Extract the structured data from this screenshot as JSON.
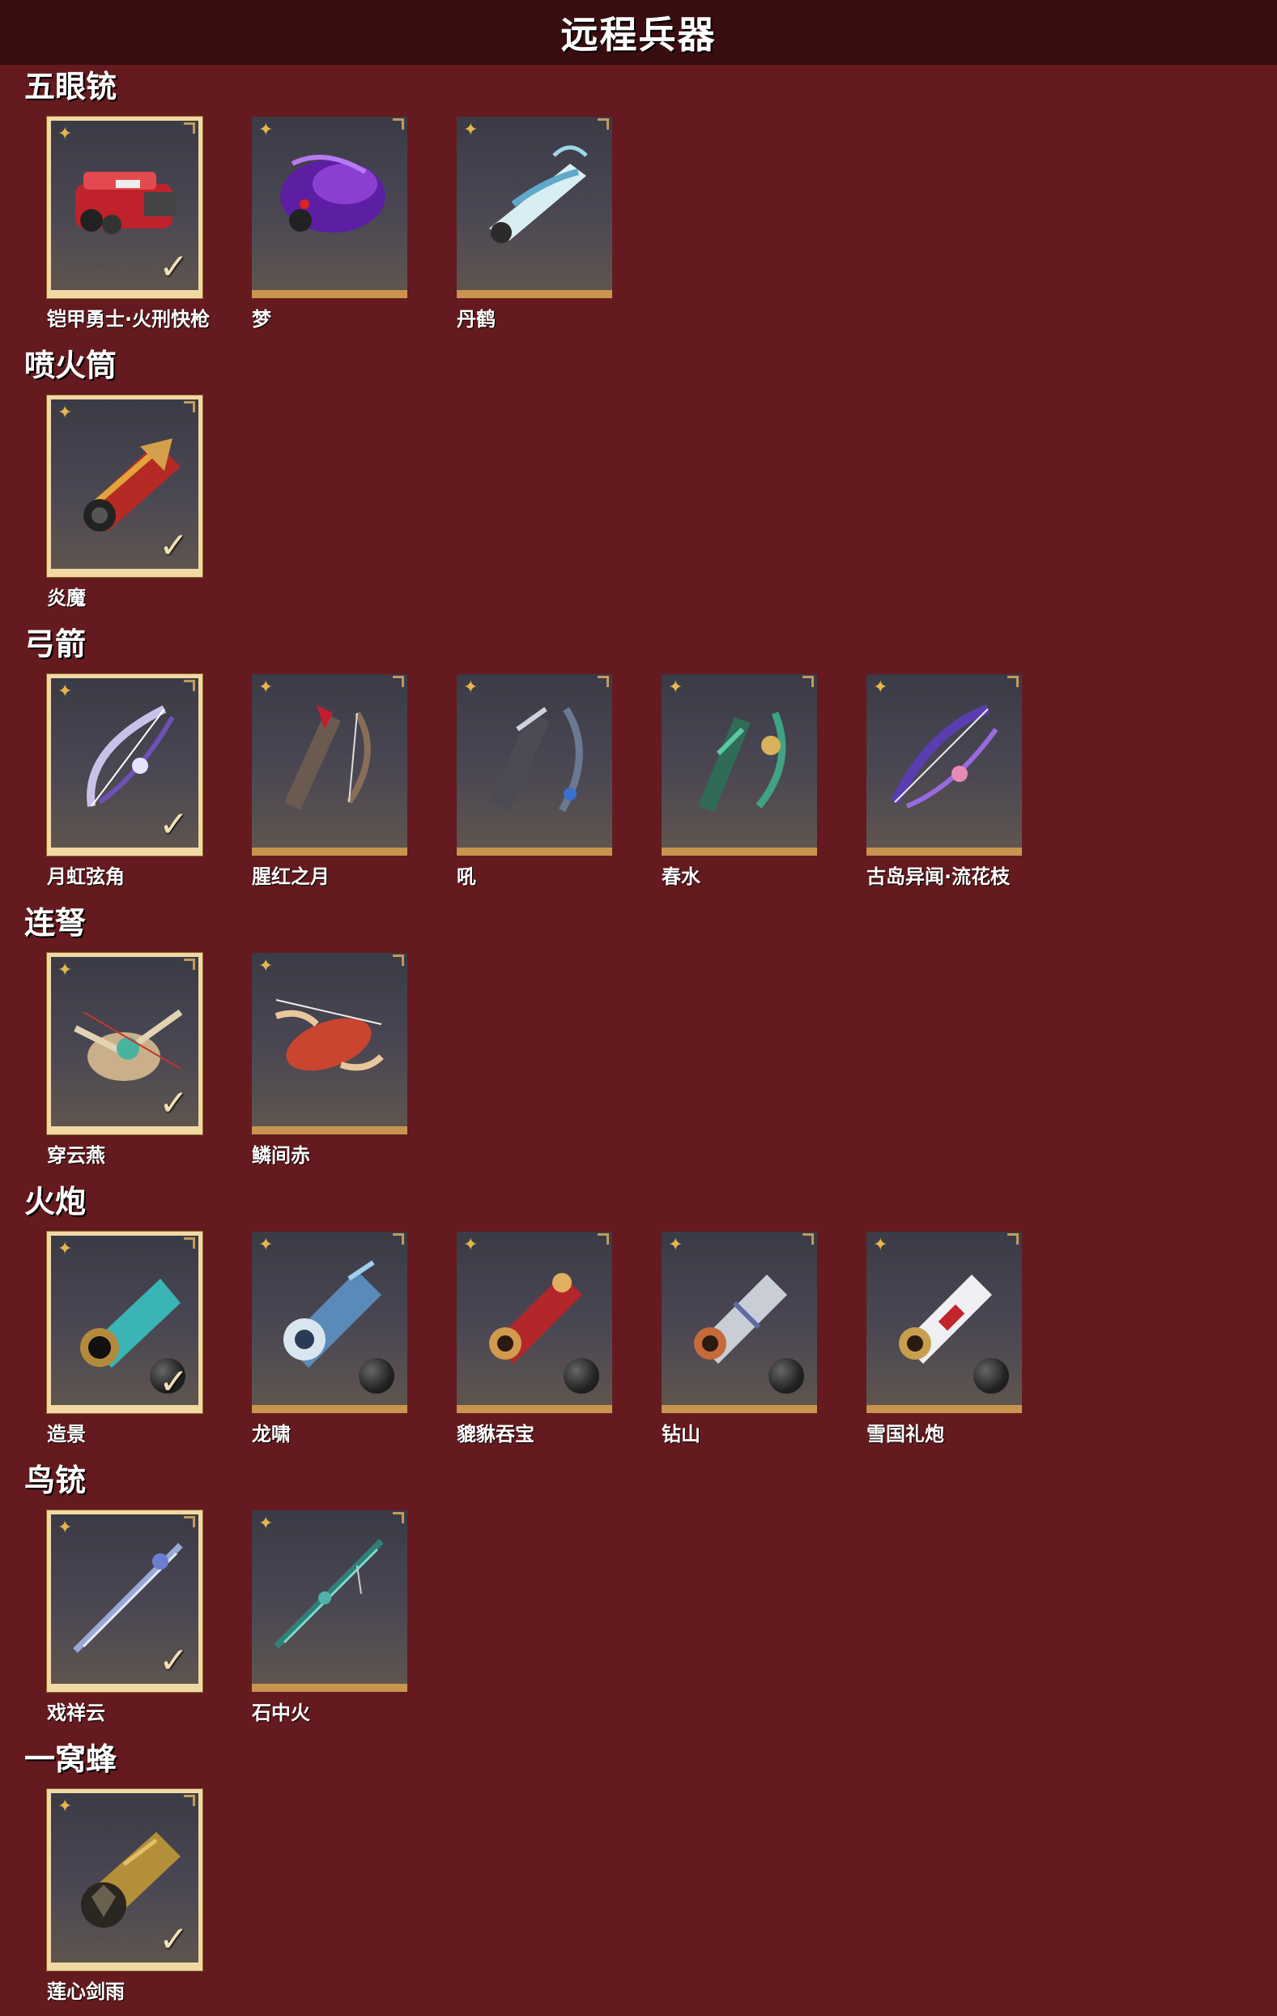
{
  "header": {
    "title": "远程兵器"
  },
  "categories": [
    {
      "title": "五眼铳",
      "items": [
        {
          "name": "铠甲勇士·火刑快枪",
          "owned": true
        },
        {
          "name": "梦",
          "owned": false
        },
        {
          "name": "丹鹤",
          "owned": false
        }
      ]
    },
    {
      "title": "喷火筒",
      "items": [
        {
          "name": "炎魔",
          "owned": true
        }
      ]
    },
    {
      "title": "弓箭",
      "items": [
        {
          "name": "月虹弦角",
          "owned": true
        },
        {
          "name": "腥红之月",
          "owned": false
        },
        {
          "name": "吼",
          "owned": false
        },
        {
          "name": "春水",
          "owned": false
        },
        {
          "name": "古岛异闻·流花枝",
          "owned": false
        }
      ]
    },
    {
      "title": "连弩",
      "items": [
        {
          "name": "穿云燕",
          "owned": true
        },
        {
          "name": "鳞间赤",
          "owned": false
        }
      ]
    },
    {
      "title": "火炮",
      "items": [
        {
          "name": "造景",
          "owned": true
        },
        {
          "name": "龙啸",
          "owned": false
        },
        {
          "name": "貔貅吞宝",
          "owned": false
        },
        {
          "name": "钻山",
          "owned": false
        },
        {
          "name": "雪国礼炮",
          "owned": false
        }
      ]
    },
    {
      "title": "鸟铳",
      "items": [
        {
          "name": "戏祥云",
          "owned": true
        },
        {
          "name": "石中火",
          "owned": false
        }
      ]
    },
    {
      "title": "一窝蜂",
      "items": [
        {
          "name": "莲心剑雨",
          "owned": true
        }
      ]
    }
  ],
  "icons": {
    "corner": "✦",
    "check": "✓"
  },
  "colors": {
    "background": "#641a1e",
    "header": "#3a0d10",
    "card_border": "#c8944f",
    "owned_border": "#f2d9a4",
    "accent": "#e7b54c"
  }
}
